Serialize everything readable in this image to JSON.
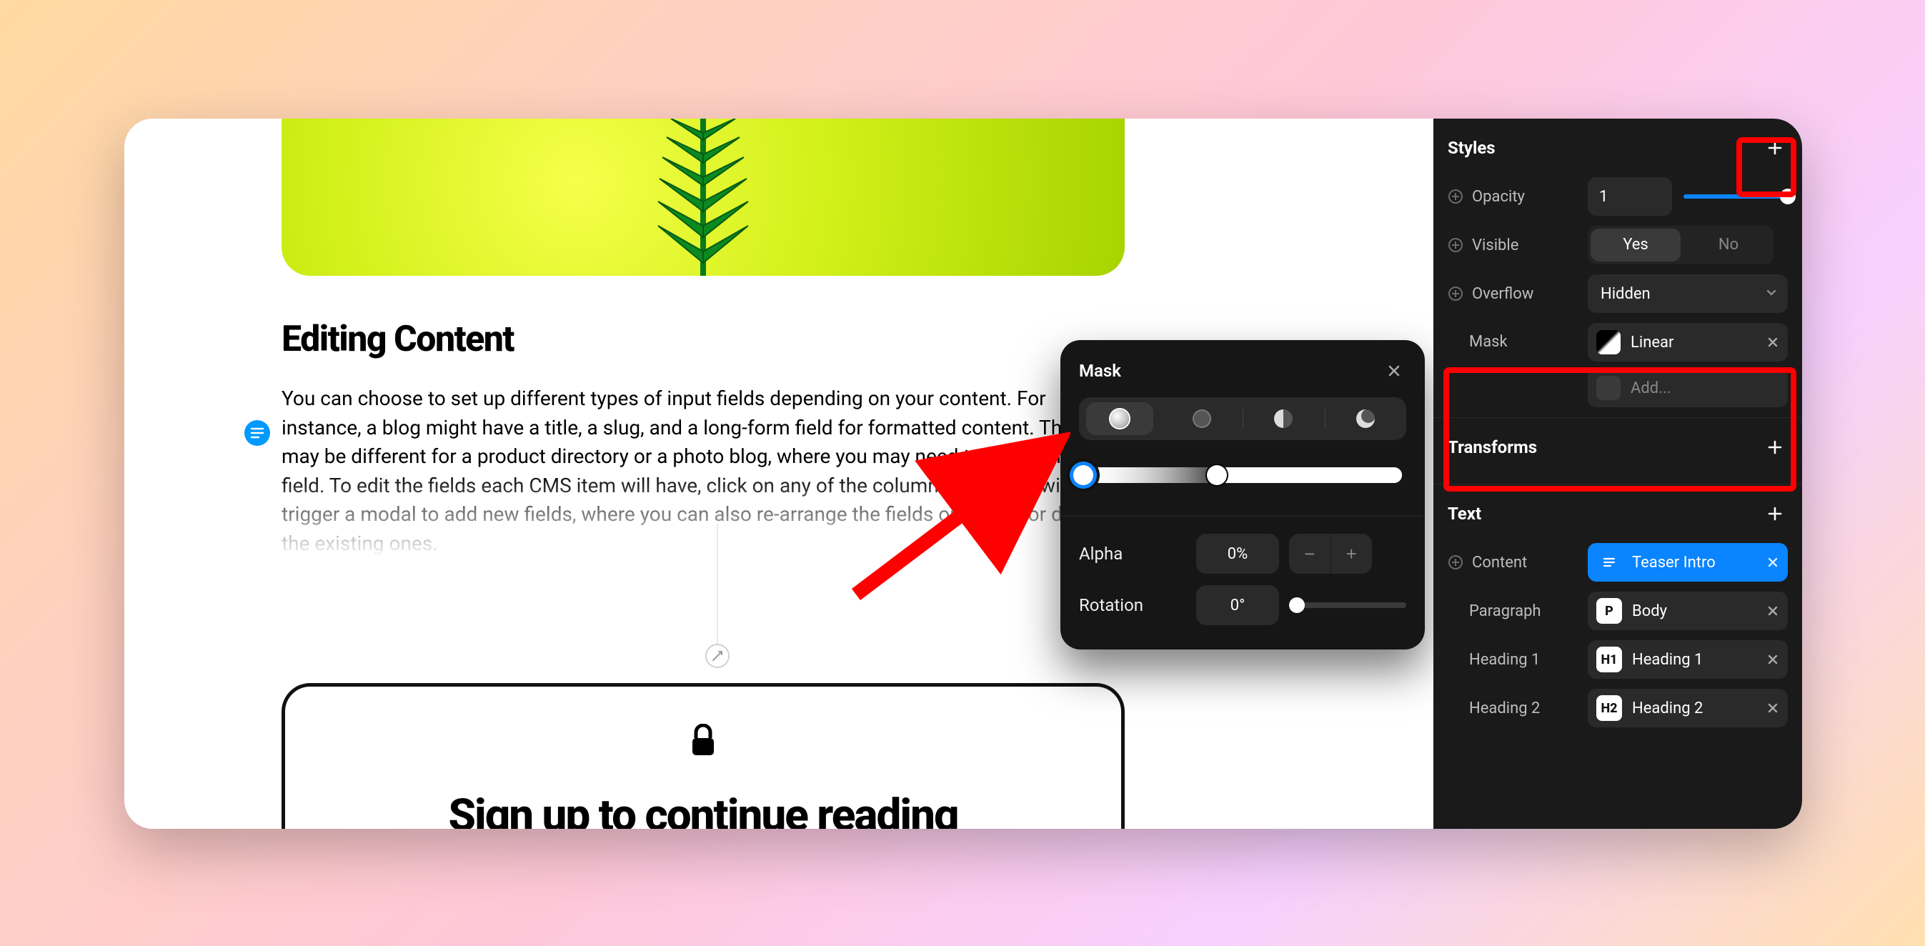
{
  "popover": {
    "title": "Mask",
    "alpha_label": "Alpha",
    "alpha_value": "0%",
    "rotation_label": "Rotation",
    "rotation_value": "0°"
  },
  "canvas": {
    "heading": "Editing Content",
    "paragraph": "You can choose to set up different types of input fields depending on your content. For instance, a blog might have a title, a slug, and a long-form field for formatted content. These may be different for a product directory or a photo blog, where you may need to add an image field. To edit the fields each CMS item will have, click on any of the column titles. This will trigger a modal to add new fields, where you can also re-arrange the fields or modify or delete the existing ones.",
    "signup_heading": "Sign up to continue reading"
  },
  "panel": {
    "styles": {
      "title": "Styles",
      "opacity_label": "Opacity",
      "opacity_value": "1",
      "visible_label": "Visible",
      "visible_yes": "Yes",
      "visible_no": "No",
      "overflow_label": "Overflow",
      "overflow_value": "Hidden",
      "mask_label": "Mask",
      "mask_value": "Linear",
      "mask_add": "Add..."
    },
    "transforms": {
      "title": "Transforms"
    },
    "text": {
      "title": "Text",
      "content_label": "Content",
      "content_chip": "Teaser Intro",
      "paragraph_label": "Paragraph",
      "paragraph_tag": "P",
      "paragraph_value": "Body",
      "h1_label": "Heading 1",
      "h1_tag": "H1",
      "h1_value": "Heading 1",
      "h2_label": "Heading 2",
      "h2_tag": "H2",
      "h2_value": "Heading 2"
    }
  }
}
